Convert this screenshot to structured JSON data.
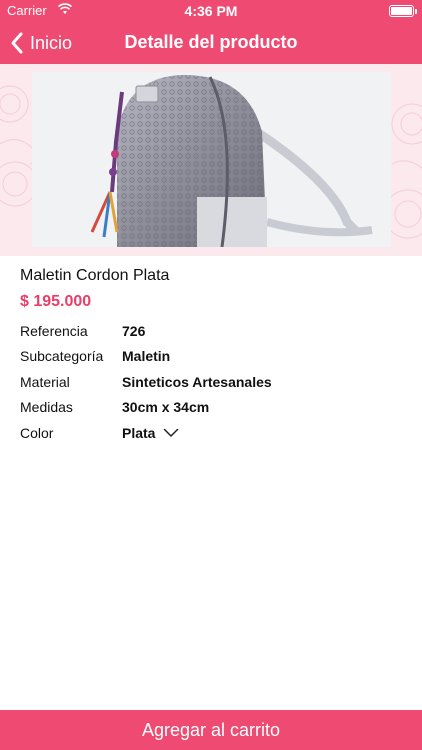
{
  "status_bar": {
    "carrier": "Carrier",
    "time": "4:36 PM"
  },
  "nav": {
    "back_label": "Inicio",
    "title": "Detalle del producto"
  },
  "product": {
    "name": "Maletin Cordon Plata",
    "price": "$ 195.000",
    "details": [
      {
        "label": "Referencia",
        "value": "726"
      },
      {
        "label": "Subcategoría",
        "value": "Maletin"
      },
      {
        "label": "Material",
        "value": "Sinteticos Artesanales"
      },
      {
        "label": "Medidas",
        "value": "30cm x 34cm"
      }
    ],
    "color_label": "Color",
    "color_value": "Plata"
  },
  "cart_button_label": "Agregar al carrito",
  "colors": {
    "brand": "#ef4b72",
    "price": "#e83e68"
  },
  "icons": {
    "back": "chevron-left-icon",
    "dropdown": "chevron-down-icon",
    "wifi": "wifi-icon",
    "battery": "battery-icon"
  }
}
